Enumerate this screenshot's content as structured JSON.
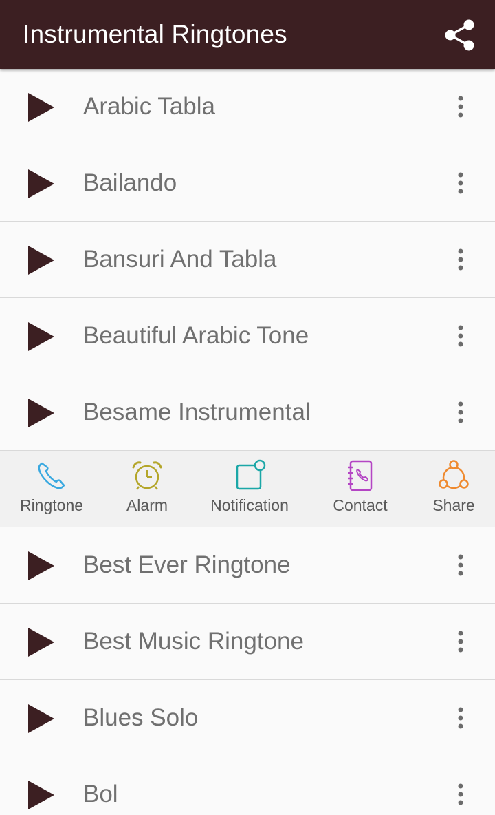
{
  "app": {
    "title": "Instrumental Ringtones",
    "header_color": "#3c1f22"
  },
  "header": {
    "share_icon": "share-icon"
  },
  "ringtones_top": [
    {
      "name": "Arabic Tabla"
    },
    {
      "name": "Bailando"
    },
    {
      "name": "Bansuri And Tabla"
    },
    {
      "name": "Beautiful Arabic Tone"
    },
    {
      "name": "Besame Instrumental"
    }
  ],
  "actions": [
    {
      "label": "Ringtone",
      "icon": "phone-icon",
      "color": "#3aa9e0"
    },
    {
      "label": "Alarm",
      "icon": "alarm-clock-icon",
      "color": "#b4a62a"
    },
    {
      "label": "Notification",
      "icon": "notification-icon",
      "color": "#1ba7a7"
    },
    {
      "label": "Contact",
      "icon": "contact-book-icon",
      "color": "#b445c4"
    },
    {
      "label": "Share",
      "icon": "share-circle-icon",
      "color": "#ef8a2f"
    }
  ],
  "ringtones_bottom": [
    {
      "name": "Best Ever Ringtone"
    },
    {
      "name": "Best Music Ringtone"
    },
    {
      "name": "Blues Solo"
    },
    {
      "name": "Bol"
    }
  ]
}
